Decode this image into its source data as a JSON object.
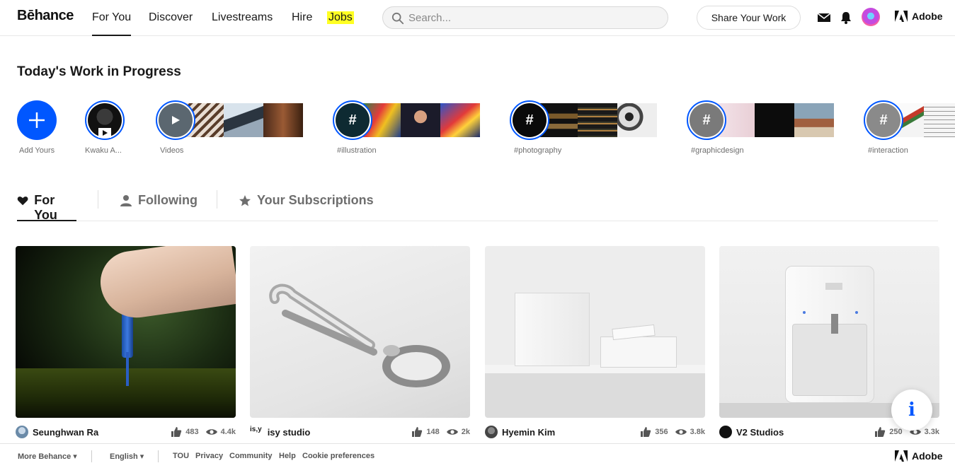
{
  "nav": {
    "logo": "Bēhance",
    "links": [
      "For You",
      "Discover",
      "Livestreams",
      "Hire",
      "Jobs"
    ],
    "search_placeholder": "Search...",
    "share_label": "Share Your Work",
    "adobe_label": "Adobe"
  },
  "wip": {
    "title": "Today's Work in Progress",
    "add_label": "Add Yours",
    "items": [
      {
        "label": "Kwaku A..."
      },
      {
        "label": "Videos"
      },
      {
        "label": "#illustration",
        "glyph": "#"
      },
      {
        "label": "#photography",
        "glyph": "#"
      },
      {
        "label": "#graphicdesign",
        "glyph": "#"
      },
      {
        "label": "#interaction",
        "glyph": "#"
      }
    ]
  },
  "tabs": [
    "For You",
    "Following",
    "Your Subscriptions"
  ],
  "projects": [
    {
      "owner": "Seunghwan Ra",
      "likes": "483",
      "views": "4.4k"
    },
    {
      "owner": "isy studio",
      "owner_badge": "is,y",
      "likes": "148",
      "views": "2k"
    },
    {
      "owner": "Hyemin Kim",
      "likes": "356",
      "views": "3.8k"
    },
    {
      "owner": "V2 Studios",
      "likes": "250",
      "views": "3.3k"
    }
  ],
  "info_glyph": "i",
  "footer": {
    "more": "More Behance ▾",
    "language": "English ▾",
    "links": [
      "TOU",
      "Privacy",
      "Community",
      "Help",
      "Cookie preferences"
    ],
    "adobe_label": "Adobe"
  },
  "colors": {
    "accent": "#0057ff",
    "jobs_highlight": "#ffff23"
  },
  "icons": [
    "search-icon",
    "mail-icon",
    "bell-icon",
    "heart-icon",
    "person-icon",
    "star-icon",
    "thumbs-up-icon",
    "eye-icon",
    "play-icon",
    "plus-icon",
    "info-icon",
    "adobe-logo-icon"
  ]
}
